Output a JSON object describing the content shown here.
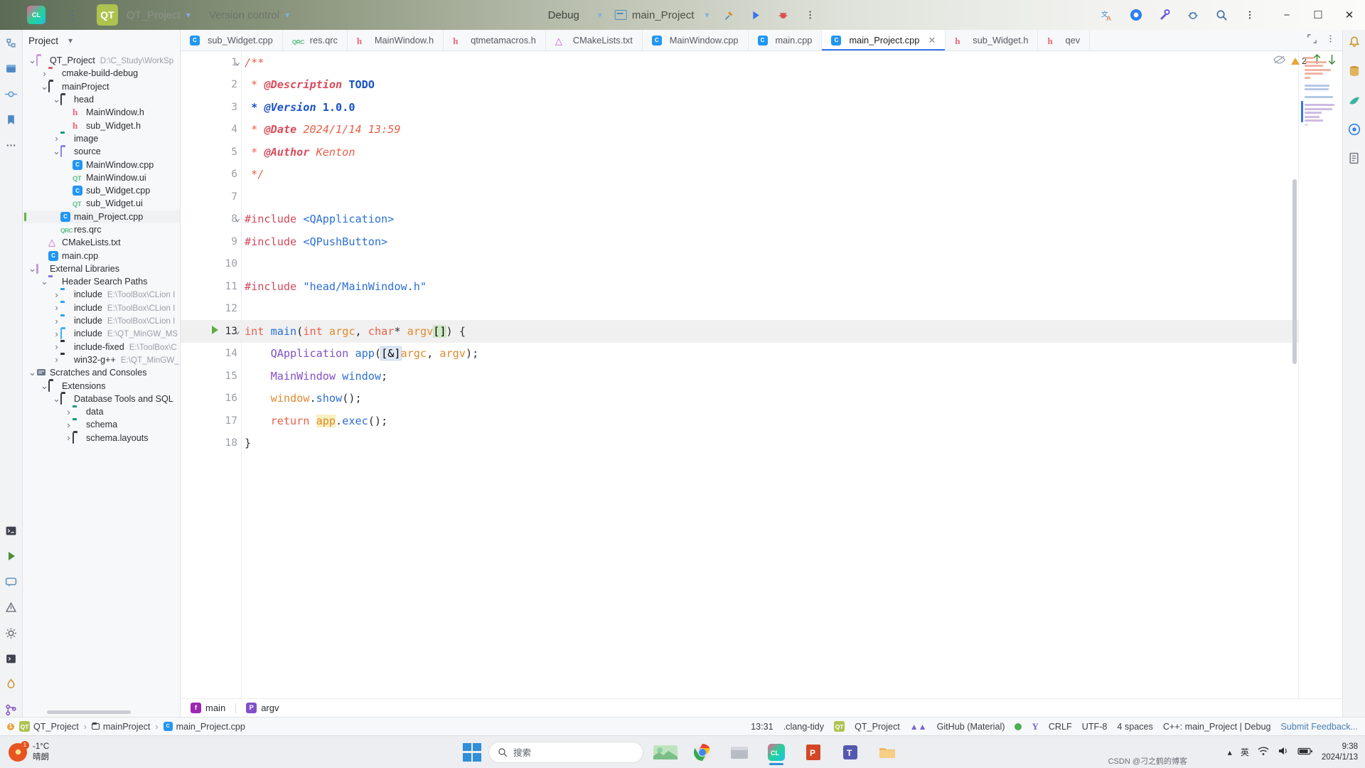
{
  "titlebar": {
    "logo_label": "CL",
    "qt_badge": "QT",
    "project_name": "QT_Project",
    "vcs_label": "Version control",
    "debug_label": "Debug",
    "run_config": "main_Project",
    "icons": [
      "more-options-icon",
      "hammer-build-icon",
      "run-icon",
      "debug-icon",
      "more-vertical-icon",
      "translate-icon",
      "ai-assistant-icon",
      "settings-wrench-icon",
      "bug-icon",
      "search-icon",
      "more-vertical-icon"
    ],
    "window_controls": [
      "minimize",
      "maximize",
      "close"
    ]
  },
  "left_rail": {
    "icons": [
      "structure-icon",
      "project-icon",
      "commit-icon",
      "bookmarks-icon",
      "more-tool-windows-icon",
      "terminal-icon",
      "run-panel-icon",
      "messages-icon",
      "problems-icon",
      "settings-icon",
      "services-icon",
      "profiler-icon",
      "git-branch-icon"
    ]
  },
  "right_rail": {
    "icons": [
      "notifications-icon",
      "database-icon",
      "gradle-icon",
      "ai-chat-icon",
      "document-icon"
    ]
  },
  "project_panel": {
    "title": "Project",
    "chevron": "chevron-down-icon",
    "tree": [
      {
        "depth": 0,
        "arrow": "down",
        "icon": "folder-outline-purple",
        "label": "QT_Project",
        "path": "D:\\C_Study\\WorkSp",
        "selected": false
      },
      {
        "depth": 1,
        "arrow": "right",
        "icon": "folder-red",
        "label": "cmake-build-debug",
        "path": "",
        "selected": false
      },
      {
        "depth": 1,
        "arrow": "down",
        "icon": "folder-outline-dark",
        "label": "mainProject",
        "path": "",
        "selected": false
      },
      {
        "depth": 2,
        "arrow": "down",
        "icon": "folder-outline-dark",
        "label": "head",
        "path": "",
        "selected": false
      },
      {
        "depth": 3,
        "arrow": "none",
        "icon": "h-file",
        "label": "MainWindow.h",
        "path": "",
        "selected": false
      },
      {
        "depth": 3,
        "arrow": "none",
        "icon": "h-file",
        "label": "sub_Widget.h",
        "path": "",
        "selected": false
      },
      {
        "depth": 2,
        "arrow": "right",
        "icon": "folder-teal-image",
        "label": "image",
        "path": "",
        "selected": false
      },
      {
        "depth": 2,
        "arrow": "down",
        "icon": "folder-purple-outline",
        "label": "source",
        "path": "",
        "selected": false
      },
      {
        "depth": 3,
        "arrow": "none",
        "icon": "cpp-file",
        "label": "MainWindow.cpp",
        "path": "",
        "selected": false
      },
      {
        "depth": 3,
        "arrow": "none",
        "icon": "ui-file",
        "label": "MainWindow.ui",
        "path": "",
        "selected": false
      },
      {
        "depth": 3,
        "arrow": "none",
        "icon": "cpp-file",
        "label": "sub_Widget.cpp",
        "path": "",
        "selected": false
      },
      {
        "depth": 3,
        "arrow": "none",
        "icon": "ui-file",
        "label": "sub_Widget.ui",
        "path": "",
        "selected": false
      },
      {
        "depth": 2,
        "arrow": "none",
        "icon": "cpp-file",
        "label": "main_Project.cpp",
        "path": "",
        "selected": true
      },
      {
        "depth": 2,
        "arrow": "none",
        "icon": "qrc-file",
        "label": "res.qrc",
        "path": "",
        "selected": false
      },
      {
        "depth": 1,
        "arrow": "none",
        "icon": "cmake-file",
        "label": "CMakeLists.txt",
        "path": "",
        "selected": false
      },
      {
        "depth": 1,
        "arrow": "none",
        "icon": "cpp-file",
        "label": "main.cpp",
        "path": "",
        "selected": false
      },
      {
        "depth": 0,
        "arrow": "down",
        "icon": "library-icon",
        "label": "External Libraries",
        "path": "",
        "selected": false
      },
      {
        "depth": 1,
        "arrow": "down",
        "icon": "folder-purple",
        "label": "Header Search Paths",
        "path": "",
        "selected": false
      },
      {
        "depth": 2,
        "arrow": "right",
        "icon": "folder-include-blue",
        "label": "include",
        "path": "E:\\ToolBox\\CLion I",
        "selected": false
      },
      {
        "depth": 2,
        "arrow": "right",
        "icon": "folder-include-blue",
        "label": "include",
        "path": "E:\\ToolBox\\CLion I",
        "selected": false
      },
      {
        "depth": 2,
        "arrow": "right",
        "icon": "folder-include-blue",
        "label": "include",
        "path": "E:\\ToolBox\\CLion I",
        "selected": false
      },
      {
        "depth": 2,
        "arrow": "right",
        "icon": "folder-include-light",
        "label": "include",
        "path": "E:\\QT_MinGW_MS",
        "selected": false
      },
      {
        "depth": 2,
        "arrow": "right",
        "icon": "folder-black",
        "label": "include-fixed",
        "path": "E:\\ToolBox\\C",
        "selected": false
      },
      {
        "depth": 2,
        "arrow": "right",
        "icon": "folder-black",
        "label": "win32-g++",
        "path": "E:\\QT_MinGW_",
        "selected": false
      },
      {
        "depth": 0,
        "arrow": "down",
        "icon": "scratches-icon",
        "label": "Scratches and Consoles",
        "path": "",
        "selected": false
      },
      {
        "depth": 1,
        "arrow": "down",
        "icon": "folder-outline-dark",
        "label": "Extensions",
        "path": "",
        "selected": false
      },
      {
        "depth": 2,
        "arrow": "down",
        "icon": "folder-outline-dark",
        "label": "Database Tools and SQL",
        "path": "",
        "selected": false
      },
      {
        "depth": 3,
        "arrow": "right",
        "icon": "folder-teal-image",
        "label": "data",
        "path": "",
        "selected": false
      },
      {
        "depth": 3,
        "arrow": "right",
        "icon": "folder-teal-image",
        "label": "schema",
        "path": "",
        "selected": false
      },
      {
        "depth": 3,
        "arrow": "right",
        "icon": "folder-outline-dark",
        "label": "schema.layouts",
        "path": "",
        "selected": false
      }
    ]
  },
  "tabs": [
    {
      "label": "sub_Widget.cpp",
      "icon": "cpp-file",
      "active": false,
      "closable": false
    },
    {
      "label": "res.qrc",
      "icon": "qrc-file",
      "active": false,
      "closable": false
    },
    {
      "label": "MainWindow.h",
      "icon": "h-file",
      "active": false,
      "closable": false
    },
    {
      "label": "qtmetamacros.h",
      "icon": "h-file",
      "active": false,
      "closable": false
    },
    {
      "label": "CMakeLists.txt",
      "icon": "cmake-file",
      "active": false,
      "closable": false
    },
    {
      "label": "MainWindow.cpp",
      "icon": "cpp-file",
      "active": false,
      "closable": false
    },
    {
      "label": "main.cpp",
      "icon": "cpp-file",
      "active": false,
      "closable": false
    },
    {
      "label": "main_Project.cpp",
      "icon": "cpp-file",
      "active": true,
      "closable": true
    },
    {
      "label": "sub_Widget.h",
      "icon": "h-file",
      "active": false,
      "closable": false
    },
    {
      "label": "qev",
      "icon": "h-file",
      "active": false,
      "closable": false
    }
  ],
  "tabstrip_right": {
    "icons": [
      "expand-editor-icon",
      "more-vertical-icon"
    ]
  },
  "editor": {
    "inspections": {
      "hide_icon": "eye-off-icon",
      "warning_count": "2",
      "up_icon": "arrow-up-icon",
      "down_icon": "arrow-down-icon"
    },
    "current_line": 13,
    "lines": [
      {
        "n": 1,
        "fold": "down",
        "text": "/**"
      },
      {
        "n": 2,
        "fold": "",
        "text": " * @Description TODO"
      },
      {
        "n": 3,
        "fold": "",
        "text": " * @Version 1.0.0"
      },
      {
        "n": 4,
        "fold": "",
        "text": " * @Date 2024/1/14 13:59"
      },
      {
        "n": 5,
        "fold": "",
        "text": " * @Author Kenton"
      },
      {
        "n": 6,
        "fold": "",
        "text": " */"
      },
      {
        "n": 7,
        "fold": "",
        "text": ""
      },
      {
        "n": 8,
        "fold": "down",
        "text": "#include <QApplication>"
      },
      {
        "n": 9,
        "fold": "",
        "text": "#include <QPushButton>"
      },
      {
        "n": 10,
        "fold": "",
        "text": ""
      },
      {
        "n": 11,
        "fold": "",
        "text": "#include \"head/MainWindow.h\""
      },
      {
        "n": 12,
        "fold": "",
        "text": ""
      },
      {
        "n": 13,
        "fold": "down",
        "text": "int main(int argc, char* argv[]) {",
        "run_marker": true
      },
      {
        "n": 14,
        "fold": "",
        "text": "    QApplication app([&]argc, argv);"
      },
      {
        "n": 15,
        "fold": "",
        "text": "    MainWindow window;"
      },
      {
        "n": 16,
        "fold": "",
        "text": "    window.show();"
      },
      {
        "n": 17,
        "fold": "",
        "text": "    return app.exec();"
      },
      {
        "n": 18,
        "fold": "",
        "text": "}"
      }
    ]
  },
  "breadcrumbs": [
    {
      "icon": "function-icon",
      "label": "main"
    },
    {
      "icon": "parameter-icon",
      "label": "argv"
    }
  ],
  "statusbar": {
    "crumbs": [
      {
        "icon": "warning-count-icon",
        "label": "QT_Project"
      },
      {
        "icon": "folder-icon",
        "label": "mainProject"
      },
      {
        "icon": "cpp-file",
        "label": "main_Project.cpp"
      }
    ],
    "problem_count": "1",
    "caret": "13:31",
    "inspection_profile": ".clang-tidy",
    "qt_project": "QT_Project",
    "theme": "GitHub (Material)",
    "line_sep": "CRLF",
    "encoding": "UTF-8",
    "indent": "4 spaces",
    "toolchain": "C++: main_Project | Debug",
    "feedback": "Submit Feedback..."
  },
  "taskbar": {
    "weather_temp": "-1°C",
    "weather_desc": "晴朗",
    "weather_badge": "1",
    "search_placeholder": "搜索",
    "apps": [
      "windows-start-icon",
      "search-box",
      "weather-widget-icon",
      "chrome-icon",
      "explorer-icon",
      "clion-icon",
      "powerpoint-icon",
      "teams-icon",
      "folder-icon"
    ],
    "tray_icons": [
      "chevron-up-icon",
      "ime-icon",
      "network-icon",
      "volume-icon",
      "battery-icon"
    ],
    "ime_label": "英",
    "time": "9:38",
    "date": "2024/1/13",
    "watermark": "CSDN @刁之鹤的博客"
  }
}
